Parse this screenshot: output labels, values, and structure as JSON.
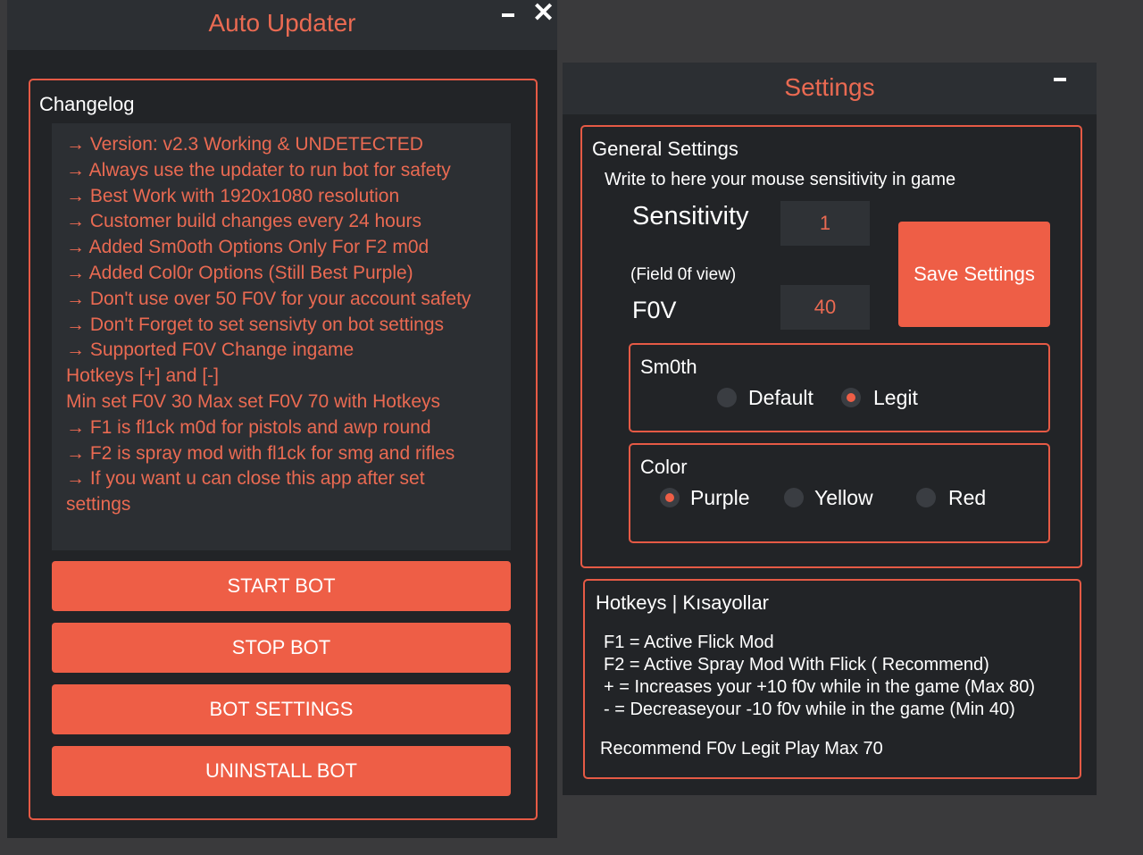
{
  "left_window": {
    "title": "Auto Updater",
    "minimize_label": "−",
    "close_label": "✕",
    "changelog": {
      "label": "Changelog",
      "lines": [
        "→ Version: v2.3 Working & UNDETECTED",
        "→ Always use the updater to run bot for safety",
        "→ Best Work with 1920x1080 resolution",
        "→ Customer build changes every 24 hours",
        "→ Added Sm0oth Options Only For F2 m0d",
        "→ Added Col0r Options (Still Best Purple)",
        "→ Don't use over 50 F0V for your account safety",
        "→ Don't Forget to set sensivty on bot settings",
        "→ Supported F0V Change ingame",
        " Hotkeys [+] and [-]",
        "Min set F0V 30 Max set F0V 70 with Hotkeys",
        "→ F1 is fl1ck m0d for pistols and awp round",
        "→ F2 is spray mod with fl1ck for smg and rifles",
        "→ If you want u can close this app after set",
        "settings"
      ]
    },
    "buttons": {
      "start": "START BOT",
      "stop": "STOP BOT",
      "settings": "BOT SETTINGS",
      "uninstall": "UNINSTALL BOT"
    }
  },
  "right_window": {
    "title": "Settings",
    "minimize_label": "−",
    "general": {
      "label": "General Settings",
      "instruction": "Write to here your mouse sensitivity in game",
      "sensitivity_label": "Sensitivity",
      "sensitivity_value": "1",
      "fov_hint": "(Field 0f view)",
      "fov_label": "F0V",
      "fov_value": "40",
      "save_label": "Save Settings"
    },
    "smooth": {
      "label": "Sm0th",
      "options": [
        "Default",
        "Legit"
      ],
      "selected": "Legit"
    },
    "color": {
      "label": "Color",
      "options": [
        "Purple",
        "Yellow",
        "Red"
      ],
      "selected": "Purple"
    },
    "hotkeys": {
      "label": "Hotkeys | Kısayollar",
      "lines": [
        "F1 = Active Flick Mod",
        "F2 = Active Spray Mod With Flick ( Recommend)",
        "+ = Increases your +10 f0v while in the game (Max 80)",
        "- = Decreaseyour -10 f0v while in the game (Min 40)"
      ],
      "recommend": "Recommend F0v Legit Play Max 70"
    }
  },
  "colors": {
    "accent": "#ee5e46",
    "title_text": "#ea6a52",
    "window_bg": "#222427",
    "panel_bg": "#2c2f33",
    "desktop_bg": "#3a3a3c"
  }
}
